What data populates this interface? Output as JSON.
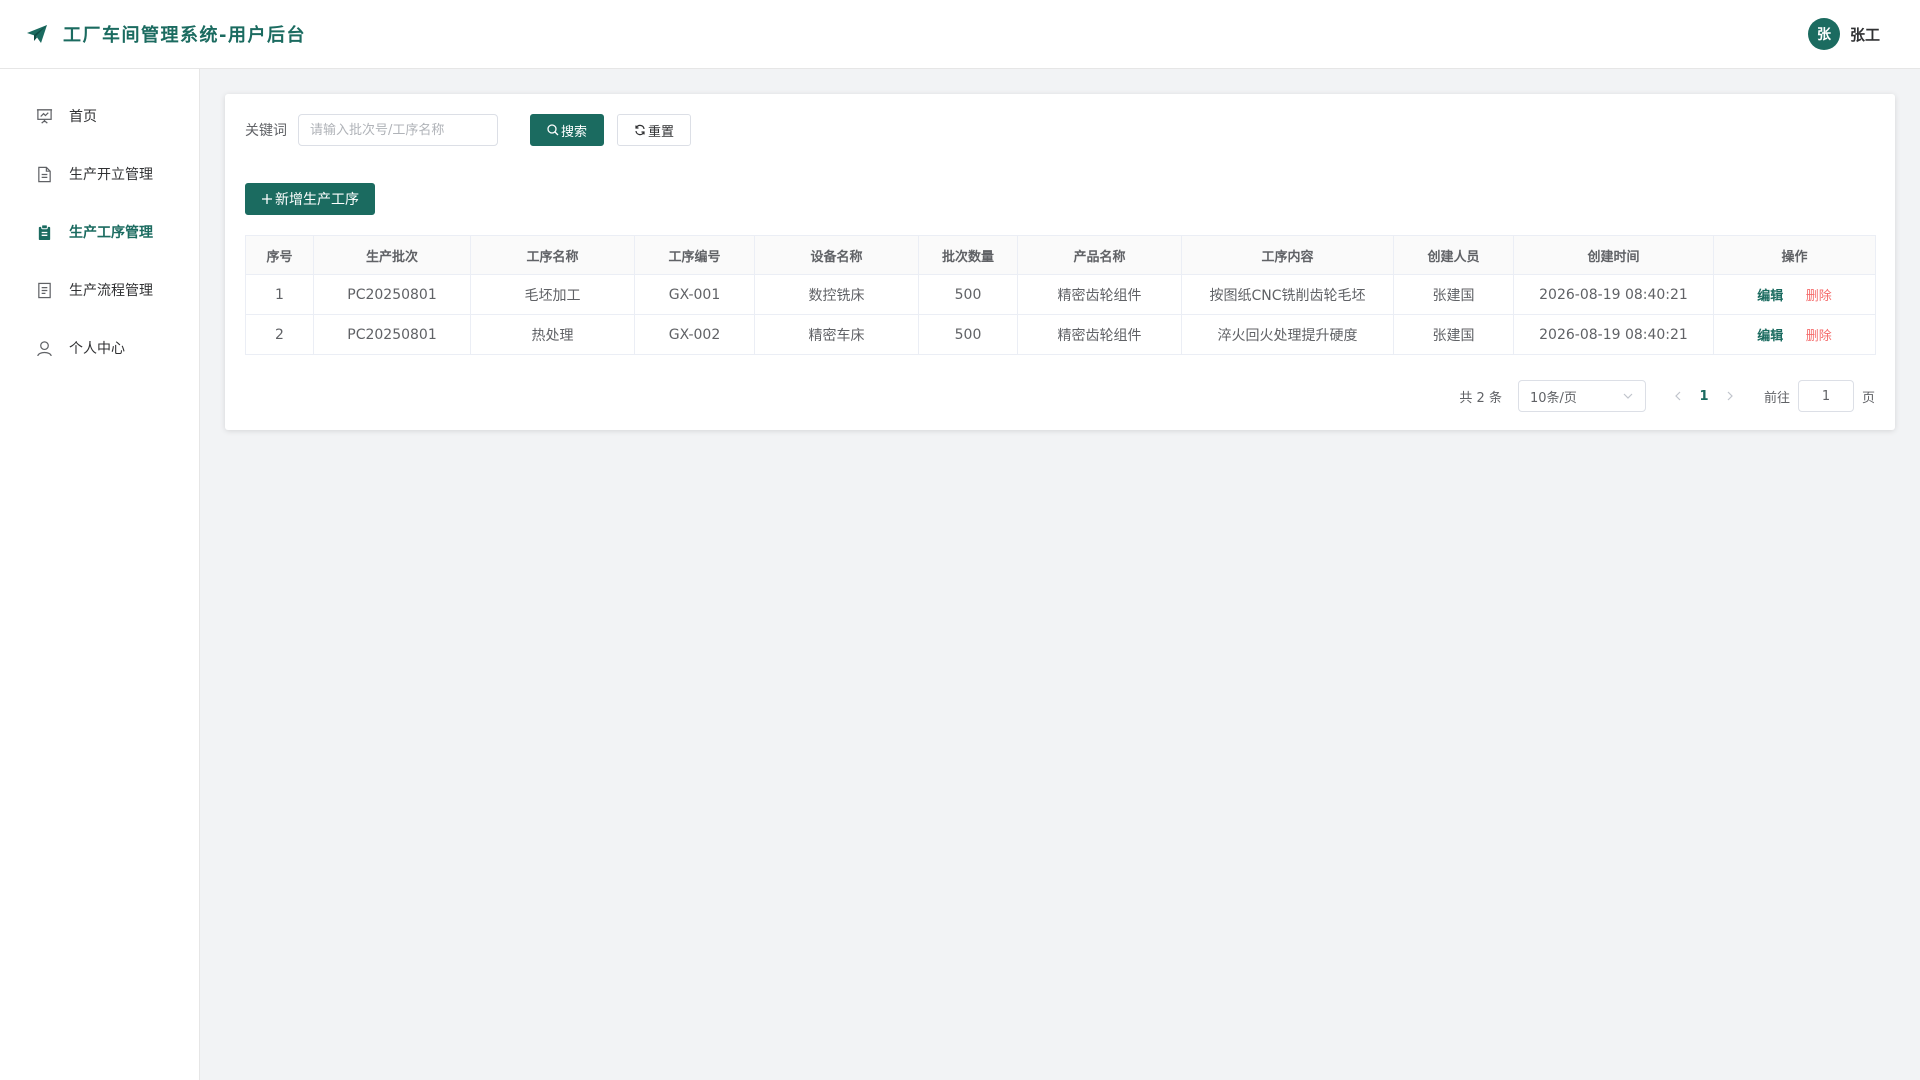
{
  "header": {
    "title": "工厂车间管理系统-用户后台",
    "avatar_text": "张",
    "username": "张工"
  },
  "sidebar": {
    "items": [
      {
        "label": "首页",
        "icon": "presentation-icon"
      },
      {
        "label": "生产开立管理",
        "icon": "document-icon"
      },
      {
        "label": "生产工序管理",
        "icon": "clipboard-icon",
        "active": true
      },
      {
        "label": "生产流程管理",
        "icon": "list-document-icon"
      },
      {
        "label": "个人中心",
        "icon": "user-icon"
      }
    ]
  },
  "search": {
    "label": "关键词",
    "placeholder": "请输入批次号/工序名称",
    "search_label": "搜索",
    "reset_label": "重置"
  },
  "toolbar": {
    "add_label": "新增生产工序"
  },
  "table": {
    "columns": [
      "序号",
      "生产批次",
      "工序名称",
      "工序编号",
      "设备名称",
      "批次数量",
      "产品名称",
      "工序内容",
      "创建人员",
      "创建时间",
      "操作"
    ],
    "rows": [
      [
        "1",
        "PC20250801",
        "毛坯加工",
        "GX-001",
        "数控铣床",
        "500",
        "精密齿轮组件",
        "按图纸CNC铣削齿轮毛坯",
        "张建国",
        "2026-08-19 08:40:21"
      ],
      [
        "2",
        "PC20250801",
        "热处理",
        "GX-002",
        "精密车床",
        "500",
        "精密齿轮组件",
        "淬火回火处理提升硬度",
        "张建国",
        "2026-08-19 08:40:21"
      ]
    ],
    "edit_label": "编辑",
    "delete_label": "删除"
  },
  "pagination": {
    "total_text": "共 2 条",
    "page_size": "10条/页",
    "current_page": "1",
    "goto_label": "前往",
    "goto_value": "1",
    "page_suffix": "页"
  },
  "colors": {
    "primary": "#1b6b60",
    "danger": "#f56c6c",
    "background": "#f2f3f5"
  }
}
